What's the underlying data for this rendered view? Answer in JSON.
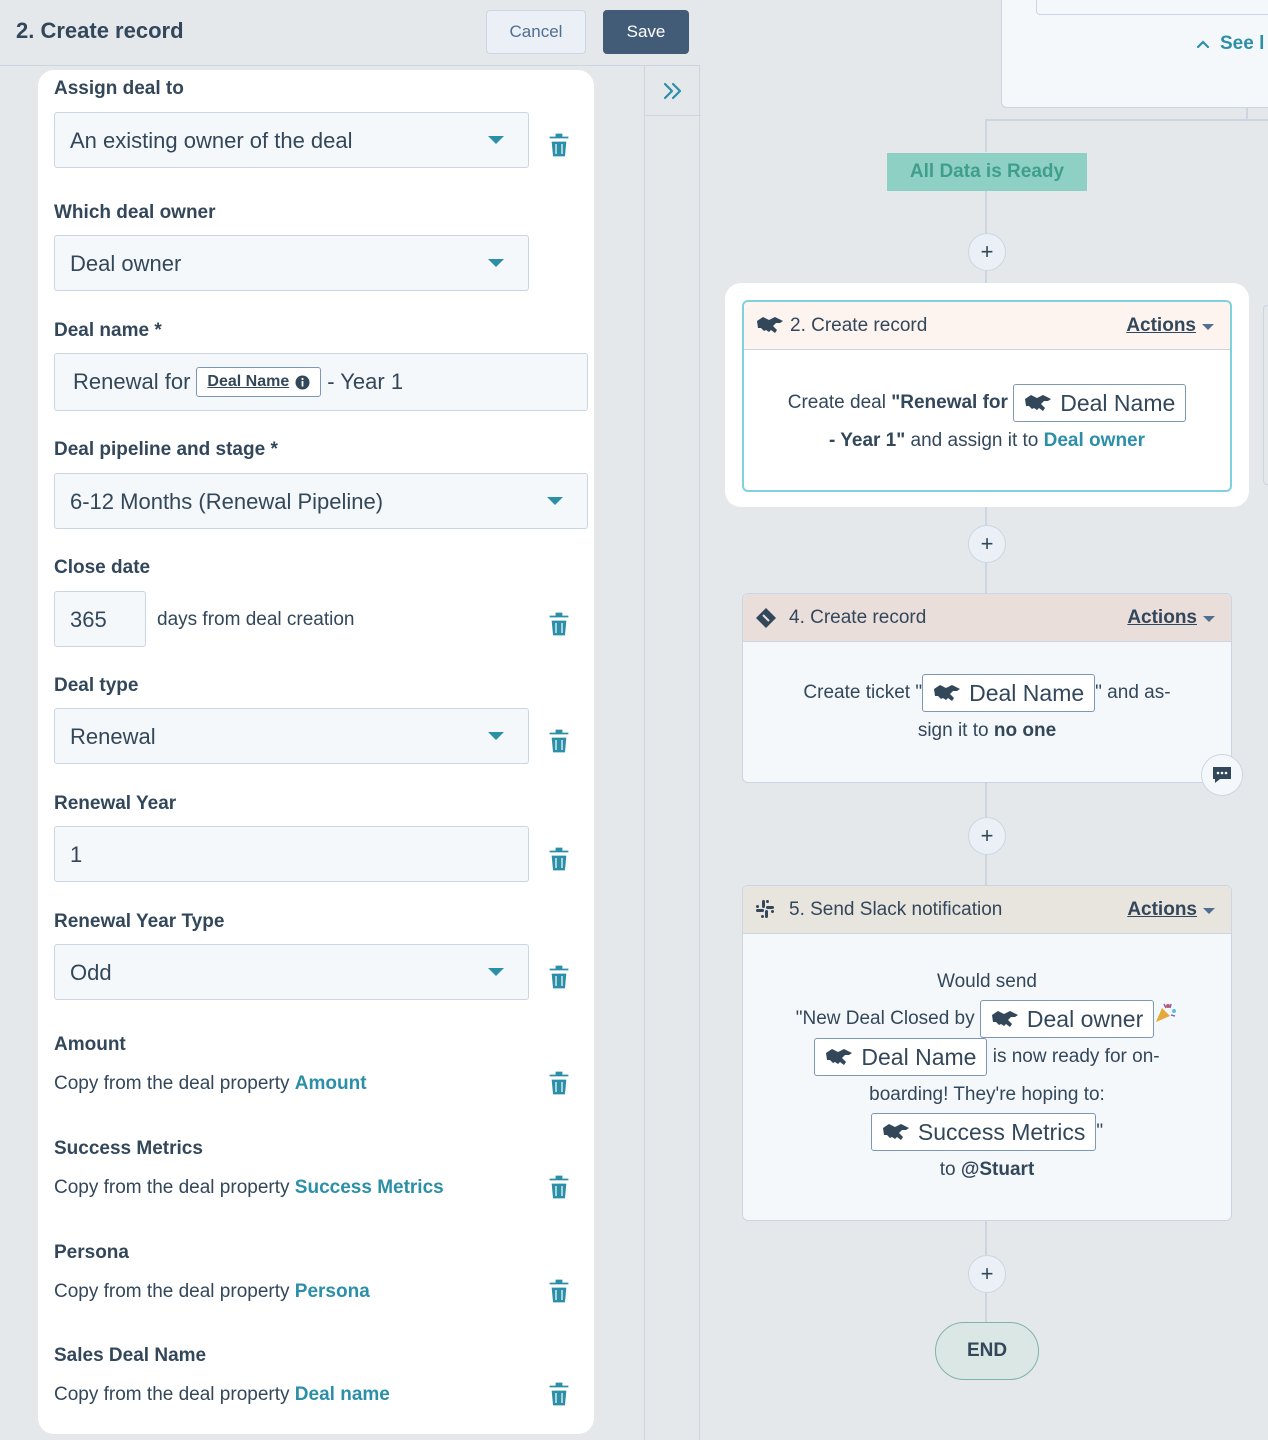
{
  "panel": {
    "title": "2. Create record",
    "cancel_label": "Cancel",
    "save_label": "Save",
    "collapse_icon": "double-chevron-right-icon"
  },
  "form": {
    "assign_label": "Assign deal to",
    "assign_value": "An existing owner of the deal",
    "which_owner_label": "Which deal owner",
    "which_owner_value": "Deal owner",
    "deal_name_label": "Deal name *",
    "deal_name_prefix": "Renewal for",
    "deal_name_token": "Deal Name",
    "deal_name_suffix": "- Year 1",
    "pipeline_label": "Deal pipeline and stage *",
    "pipeline_value": "6-12 Months (Renewal Pipeline)",
    "close_date_label": "Close date",
    "close_date_value": "365",
    "close_date_suffix": "days from deal creation",
    "deal_type_label": "Deal type",
    "deal_type_value": "Renewal",
    "renewal_year_label": "Renewal Year",
    "renewal_year_value": "1",
    "renewal_year_type_label": "Renewal Year Type",
    "renewal_year_type_value": "Odd",
    "copy_prefix": "Copy from the deal property",
    "amount_label": "Amount",
    "amount_prop": "Amount",
    "success_label": "Success Metrics",
    "success_prop": "Success Metrics",
    "persona_label": "Persona",
    "persona_prop": "Persona",
    "sales_label": "Sales Deal Name",
    "sales_prop": "Deal name"
  },
  "canvas": {
    "see_more": "See l",
    "all_data_ready": "All Data is Ready",
    "end_label": "END",
    "actions_label": "Actions",
    "card2": {
      "title": "2. Create record",
      "text1": "Create deal",
      "bold1": "\"Renewal for",
      "token": "Deal Name",
      "bold2": "- Year 1\"",
      "text2": "and assign it to",
      "link": "Deal owner"
    },
    "card4": {
      "title": "4. Create record",
      "text1": "Create ticket \"",
      "token": "Deal Name",
      "text2": "\" and as-",
      "text3": "sign it to",
      "bold": "no one"
    },
    "card5": {
      "title": "5. Send Slack notification",
      "line1": "Would send",
      "line2": "\"New Deal Closed by",
      "token_owner": "Deal owner",
      "token_name": "Deal Name",
      "line3": "is now ready for on-",
      "line4": "boarding! They're hoping to:",
      "token_metrics": "Success Metrics",
      "quote": "\"",
      "line5": "to",
      "mention": "@Stuart"
    }
  },
  "colors": {
    "accent": "#2c8fa8",
    "primary_button": "#425b76",
    "ready_badge": "#8fd0c4"
  }
}
